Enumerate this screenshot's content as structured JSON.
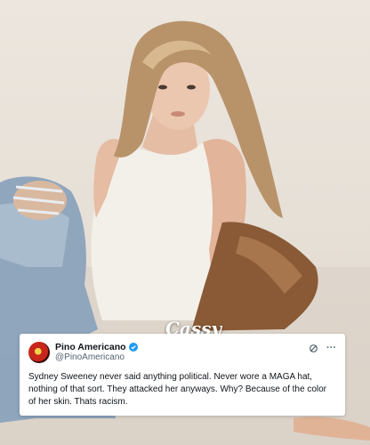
{
  "watermark": "Cassy",
  "tweet": {
    "display_name": "Pino Americano",
    "handle": "@PinoAmericano",
    "verified": true,
    "text": "Sydney Sweeney never said anything political. Never wore a MAGA hat, nothing of that sort. They attacked her anyways. Why? Because of the color of her skin. Thats racism.",
    "more_label": "···"
  },
  "colors": {
    "verified_badge": "#1d9bf0",
    "card_background": "#ffffff",
    "text_primary": "#0f1419",
    "text_secondary": "#536471"
  },
  "icons": [
    "avatar",
    "verified-badge-icon",
    "grok-icon",
    "more-options-icon"
  ]
}
